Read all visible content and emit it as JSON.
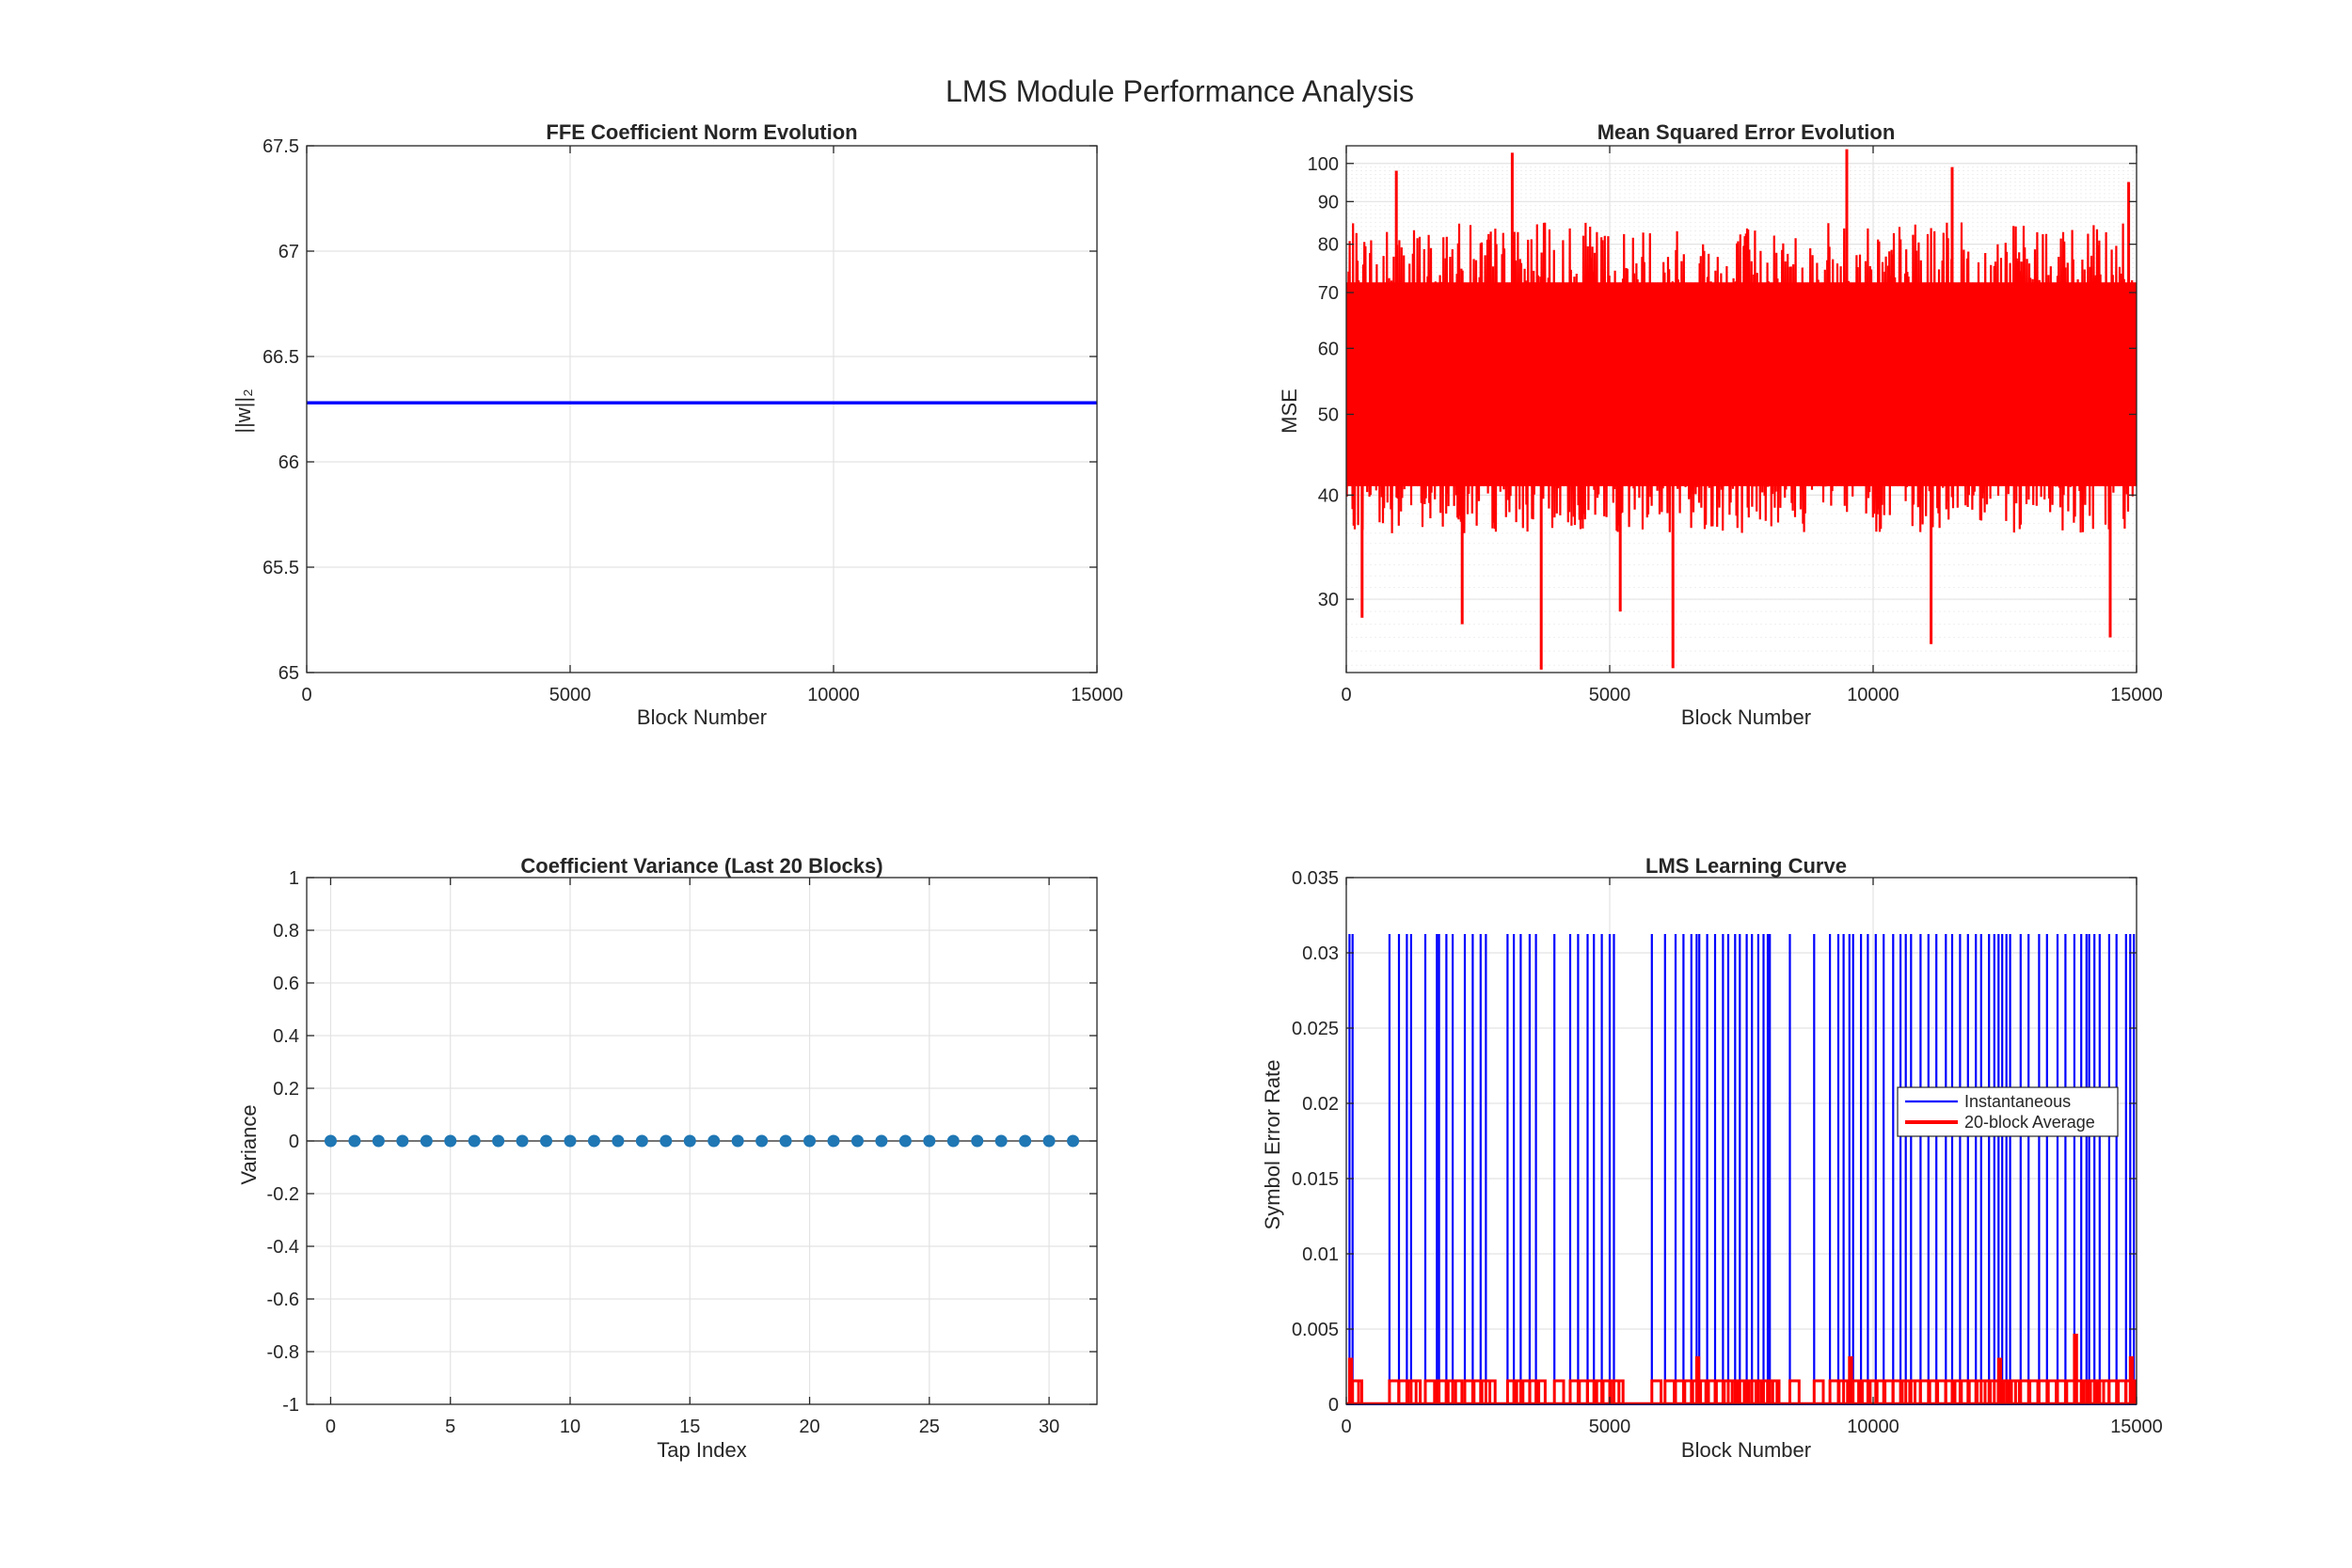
{
  "figure": {
    "suptitle": "LMS Module Performance Analysis"
  },
  "chart_data": [
    {
      "id": "norm",
      "type": "line",
      "title": "FFE Coefficient Norm Evolution",
      "xlabel": "Block Number",
      "ylabel": "||w||₂",
      "xlim": [
        0,
        15000
      ],
      "ylim": [
        65,
        67.5
      ],
      "xticks": [
        0,
        5000,
        10000,
        15000
      ],
      "yticks": [
        65,
        65.5,
        66,
        66.5,
        67,
        67.5
      ],
      "ytick_labels": [
        "65",
        "65.5",
        "66",
        "66.5",
        "67",
        "67.5"
      ],
      "grid": true,
      "series": [
        {
          "color": "#0000ff",
          "x": [
            0,
            15000
          ],
          "y": [
            66.28,
            66.28
          ]
        }
      ]
    },
    {
      "id": "mse",
      "type": "line",
      "title": "Mean Squared Error Evolution",
      "xlabel": "Block Number",
      "ylabel": "MSE",
      "yscale": "log",
      "xlim": [
        0,
        15000
      ],
      "ylim": [
        24.5,
        105
      ],
      "xticks": [
        0,
        5000,
        10000,
        15000
      ],
      "yticks": [
        30,
        40,
        50,
        60,
        70,
        80,
        90,
        100
      ],
      "grid": true,
      "minor_grid": true,
      "series": [
        {
          "color": "#ff0000",
          "description": "noisy per-block MSE, roughly 36-85 band around ~52",
          "center": 52,
          "typical_range": [
            36,
            85
          ],
          "spikes_high": [
            [
              950,
              98
            ],
            [
              3150,
              103
            ],
            [
              9500,
              104
            ],
            [
              11500,
              99
            ],
            [
              14850,
              95
            ]
          ],
          "spikes_low": [
            [
              3700,
              24.7
            ],
            [
              6200,
              24.8
            ],
            [
              11100,
              26.5
            ],
            [
              14500,
              27
            ],
            [
              300,
              28.5
            ],
            [
              2200,
              28
            ],
            [
              5200,
              29
            ]
          ]
        }
      ]
    },
    {
      "id": "variance",
      "type": "scatter",
      "title": "Coefficient Variance (Last 20 Blocks)",
      "xlabel": "Tap Index",
      "ylabel": "Variance",
      "xlim": [
        -1,
        32
      ],
      "ylim": [
        -1,
        1
      ],
      "xticks": [
        0,
        5,
        10,
        15,
        20,
        25,
        30
      ],
      "yticks": [
        -1,
        -0.8,
        -0.6,
        -0.4,
        -0.2,
        0,
        0.2,
        0.4,
        0.6,
        0.8,
        1
      ],
      "ytick_labels": [
        "-1",
        "-0.8",
        "-0.6",
        "-0.4",
        "-0.2",
        "0",
        "0.2",
        "0.4",
        "0.6",
        "0.8",
        "1"
      ],
      "grid": true,
      "series": [
        {
          "color": "#1f77b4",
          "x": [
            0,
            1,
            2,
            3,
            4,
            5,
            6,
            7,
            8,
            9,
            10,
            11,
            12,
            13,
            14,
            15,
            16,
            17,
            18,
            19,
            20,
            21,
            22,
            23,
            24,
            25,
            26,
            27,
            28,
            29,
            30,
            31
          ],
          "y": [
            0,
            0,
            0,
            0,
            0,
            0,
            0,
            0,
            0,
            0,
            0,
            0,
            0,
            0,
            0,
            0,
            0,
            0,
            0,
            0,
            0,
            0,
            0,
            0,
            0,
            0,
            0,
            0,
            0,
            0,
            0,
            0
          ]
        }
      ]
    },
    {
      "id": "learning",
      "type": "line",
      "title": "LMS Learning Curve",
      "xlabel": "Block Number",
      "ylabel": "Symbol Error Rate",
      "xlim": [
        0,
        15000
      ],
      "ylim": [
        0,
        0.035
      ],
      "xticks": [
        0,
        5000,
        10000,
        15000
      ],
      "yticks": [
        0,
        0.005,
        0.01,
        0.015,
        0.02,
        0.025,
        0.03,
        0.035
      ],
      "ytick_labels": [
        "0",
        "0.005",
        "0.01",
        "0.015",
        "0.02",
        "0.025",
        "0.03",
        "0.035"
      ],
      "grid": true,
      "legend": {
        "location": "east",
        "entries": [
          "Instantaneous",
          "20-block Average"
        ]
      },
      "series": [
        {
          "name": "Instantaneous",
          "color": "#0000ff",
          "error_value": 0.03125,
          "error_blocks": [
            60,
            120,
            820,
            1000,
            1150,
            1230,
            1500,
            1720,
            1760,
            1900,
            2020,
            2250,
            2400,
            2550,
            2650,
            3060,
            3180,
            3310,
            3480,
            3600,
            3950,
            4250,
            4400,
            4580,
            4700,
            4850,
            5000,
            5080,
            5800,
            6050,
            6250,
            6400,
            6550,
            6650,
            6700,
            6850,
            7000,
            7150,
            7250,
            7380,
            7470,
            7600,
            7700,
            7820,
            7920,
            8000,
            8040,
            8420,
            8880,
            9180,
            9340,
            9440,
            9550,
            9620,
            9770,
            9900,
            10050,
            10200,
            10380,
            10520,
            10620,
            10720,
            10900,
            11050,
            11200,
            11380,
            11500,
            11650,
            11800,
            11950,
            12050,
            12200,
            12300,
            12380,
            12450,
            12530,
            12600,
            12800,
            12950,
            13150,
            13300,
            13500,
            13650,
            13820,
            13950,
            14050,
            14100,
            14200,
            14300,
            14480,
            14620,
            14800,
            14880,
            14950
          ]
        },
        {
          "name": "20-block Average",
          "color": "#ff0000",
          "bump_value": 0.0015625,
          "peaks": [
            [
              60,
              0.003
            ],
            [
              6650,
              0.0031
            ],
            [
              9550,
              0.0031
            ],
            [
              12380,
              0.003
            ],
            [
              13820,
              0.0046
            ],
            [
              14880,
              0.0031
            ]
          ]
        }
      ]
    }
  ]
}
